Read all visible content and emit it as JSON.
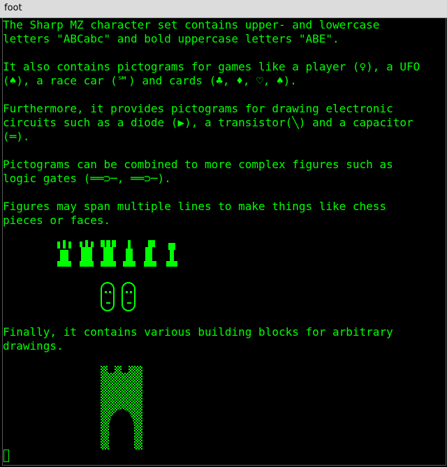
{
  "window": {
    "title": "foot"
  },
  "terminal": {
    "lines": [
      "The Sharp MZ character set contains upper- and lowercase",
      "letters \"ABCabc\" and bold uppercase letters \"ABE\".",
      "",
      "It also contains pictograms for games like a player (♀), a UFO",
      "(♠), a race car (℠) and cards (♣, ♦, ♡, ♠).",
      "",
      "Furthermore, it provides pictograms for drawing electronic",
      "circuits such as a diode (▶), a transistor(╲) and a capacitor",
      "(═).",
      "",
      "Pictograms can be combined to more complex figures such as",
      "logic gates (══⊃─, ══⊃─).",
      "",
      "Figures may span multiple lines to make things like chess",
      "pieces or faces.",
      "",
      "",
      "",
      "",
      "",
      "",
      "",
      "",
      "Finally, it contains various building blocks for arbitrary",
      "drawings."
    ]
  },
  "colors": {
    "fg": "#00ff00",
    "bg": "#000000",
    "titlebar": "#dcdcdc"
  }
}
